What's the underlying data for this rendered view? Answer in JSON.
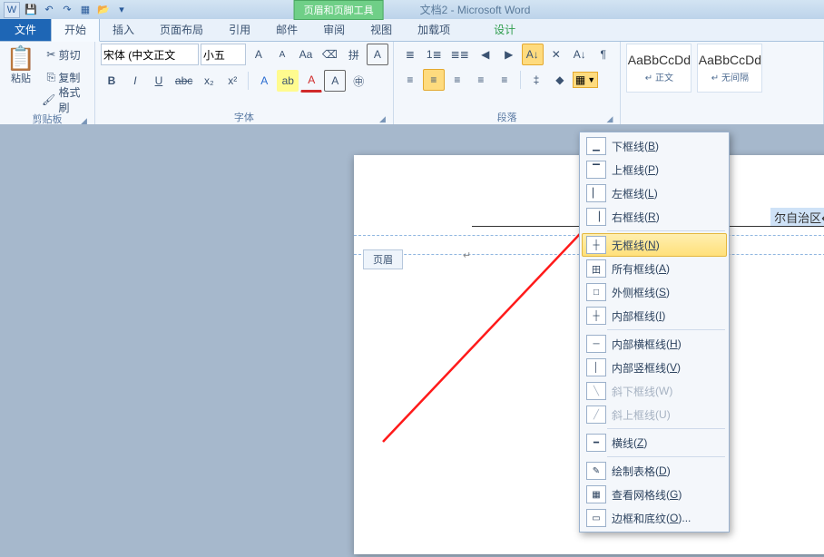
{
  "title": {
    "contextual_tab": "页眉和页脚工具",
    "document": "文档2 - Microsoft Word"
  },
  "qat": {
    "word": "W",
    "save": "💾",
    "undo": "↶",
    "redo": "↷",
    "new": "▦",
    "open": "📂",
    "more": "▾"
  },
  "tabs": {
    "file": "文件",
    "home": "开始",
    "insert": "插入",
    "layout": "页面布局",
    "references": "引用",
    "mailings": "邮件",
    "review": "审阅",
    "view": "视图",
    "addins": "加载项",
    "design": "设计"
  },
  "ribbon": {
    "clipboard": {
      "label": "剪贴板",
      "paste": "粘贴",
      "cut": "剪切",
      "copy": "复制",
      "format_painter": "格式刷"
    },
    "font": {
      "label": "字体",
      "family": "宋体 (中文正文",
      "size": "小五",
      "grow": "A",
      "shrink": "A",
      "case": "Aa",
      "clear": "⌫",
      "phonetic": "拼",
      "charborder": "A",
      "bold": "B",
      "italic": "I",
      "underline": "U",
      "strike": "abc",
      "sub": "x₂",
      "sup": "x²",
      "effects": "A",
      "highlight": "ab",
      "color": "A"
    },
    "paragraph": {
      "label": "段落",
      "bullets": "≣",
      "numbering": "1≣",
      "multilevel": "≣≣",
      "dec_indent": "◀",
      "inc_indent": "▶",
      "sort": "A↓",
      "show": "¶",
      "align_l": "≡",
      "align_c": "≡",
      "align_r": "≡",
      "align_j": "≡",
      "distribute": "≡",
      "spacing": "‡",
      "shading": "◆",
      "borders": "▦"
    },
    "styles": {
      "sample": "AaBbCcDd",
      "normal": "↵ 正文",
      "nospacing": "↵ 无间隔"
    }
  },
  "menu": {
    "bottom": "下框线",
    "bottom_k": "B",
    "top": "上框线",
    "top_k": "P",
    "left": "左框线",
    "left_k": "L",
    "right": "右框线",
    "right_k": "R",
    "none": "无框线",
    "none_k": "N",
    "all": "所有框线",
    "all_k": "A",
    "outside": "外侧框线",
    "outside_k": "S",
    "inside": "内部框线",
    "inside_k": "I",
    "inside_h": "内部横框线",
    "inside_h_k": "H",
    "inside_v": "内部竖框线",
    "inside_v_k": "V",
    "diag_down": "斜下框线",
    "diag_down_k": "W",
    "diag_up": "斜上框线",
    "diag_up_k": "U",
    "hline": "横线",
    "hline_k": "Z",
    "draw": "绘制表格",
    "draw_k": "D",
    "gridlines": "查看网格线",
    "gridlines_k": "G",
    "dialog": "边框和底纹",
    "dialog_k": "O",
    "ellipsis": "..."
  },
  "doc": {
    "header_tag": "页眉",
    "header_text": "尔自治区↵",
    "anchor": "↵"
  }
}
